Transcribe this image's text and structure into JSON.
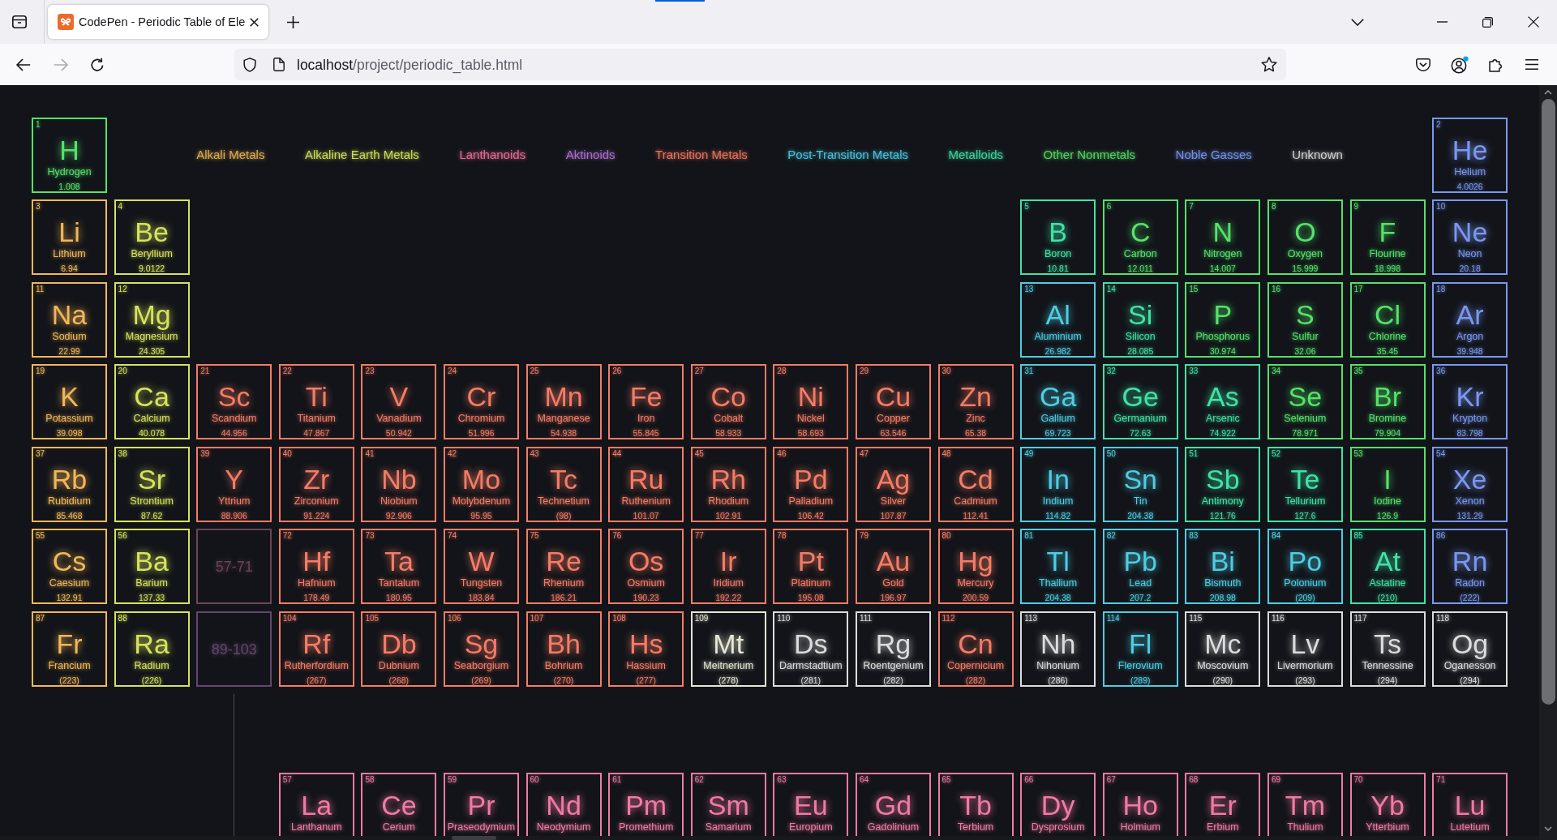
{
  "browser": {
    "tab": {
      "title": "CodePen - Periodic Table of Ele",
      "selected": true
    },
    "forward_button": {
      "disabled": true
    },
    "url": {
      "host": "localhost",
      "path": "/project/periodic_table.html"
    }
  },
  "legend": [
    {
      "label": "Alkali Metals",
      "color": "#dcaa50"
    },
    {
      "label": "Alkaline Earth Metals",
      "color": "#cbd956"
    },
    {
      "label": "Lanthanoids",
      "color": "#e56a94"
    },
    {
      "label": "Aktinoids",
      "color": "#a96cc9"
    },
    {
      "label": "Transition Metals",
      "color": "#e9715c"
    },
    {
      "label": "Post-Transition Metals",
      "color": "#47c2d9"
    },
    {
      "label": "Metalloids",
      "color": "#3bd49c"
    },
    {
      "label": "Other Nonmetals",
      "color": "#50d35f"
    },
    {
      "label": "Noble Gasses",
      "color": "#7290e6"
    },
    {
      "label": "Unknown",
      "color": "#cfcfcf"
    }
  ],
  "table": {
    "rows": [
      {
        "left": [
          {
            "kind": "element",
            "number": "1",
            "symbol": "H",
            "name": "Hydrogen",
            "weight": "1.008",
            "color": "#55e26a"
          }
        ],
        "right": [
          {
            "kind": "element",
            "number": "2",
            "symbol": "He",
            "name": "Helium",
            "weight": "4.0026",
            "color": "#7a98f2"
          }
        ]
      },
      {
        "left": [
          {
            "kind": "element",
            "number": "3",
            "symbol": "Li",
            "name": "Lithium",
            "weight": "6.94",
            "color": "#f2b75a"
          },
          {
            "kind": "element",
            "number": "4",
            "symbol": "Be",
            "name": "Beryllium",
            "weight": "9.0122",
            "color": "#d6e35c"
          }
        ],
        "right": [
          {
            "kind": "element",
            "number": "5",
            "symbol": "B",
            "name": "Boron",
            "weight": "10.81",
            "color": "#40e3a6"
          },
          {
            "kind": "element",
            "number": "6",
            "symbol": "C",
            "name": "Carbon",
            "weight": "12.011",
            "color": "#55e26a"
          },
          {
            "kind": "element",
            "number": "7",
            "symbol": "N",
            "name": "Nitrogen",
            "weight": "14.007",
            "color": "#55e26a"
          },
          {
            "kind": "element",
            "number": "8",
            "symbol": "O",
            "name": "Oxygen",
            "weight": "15.999",
            "color": "#55e26a"
          },
          {
            "kind": "element",
            "number": "9",
            "symbol": "F",
            "name": "Flourine",
            "weight": "18.998",
            "color": "#55e26a"
          },
          {
            "kind": "element",
            "number": "10",
            "symbol": "Ne",
            "name": "Neon",
            "weight": "20.18",
            "color": "#7a98f2"
          }
        ]
      },
      {
        "left": [
          {
            "kind": "element",
            "number": "11",
            "symbol": "Na",
            "name": "Sodium",
            "weight": "22.99",
            "color": "#f2b75a"
          },
          {
            "kind": "element",
            "number": "12",
            "symbol": "Mg",
            "name": "Magnesium",
            "weight": "24.305",
            "color": "#d6e35c"
          }
        ],
        "right": [
          {
            "kind": "element",
            "number": "13",
            "symbol": "Al",
            "name": "Aluminium",
            "weight": "26.982",
            "color": "#4fcde3"
          },
          {
            "kind": "element",
            "number": "14",
            "symbol": "Si",
            "name": "Silicon",
            "weight": "28.085",
            "color": "#40e3a6"
          },
          {
            "kind": "element",
            "number": "15",
            "symbol": "P",
            "name": "Phosphorus",
            "weight": "30.974",
            "color": "#55e26a"
          },
          {
            "kind": "element",
            "number": "16",
            "symbol": "S",
            "name": "Sulfur",
            "weight": "32.06",
            "color": "#55e26a"
          },
          {
            "kind": "element",
            "number": "17",
            "symbol": "Cl",
            "name": "Chlorine",
            "weight": "35.45",
            "color": "#55e26a"
          },
          {
            "kind": "element",
            "number": "18",
            "symbol": "Ar",
            "name": "Argon",
            "weight": "39.948",
            "color": "#7a98f2"
          }
        ]
      },
      {
        "left": [
          {
            "kind": "element",
            "number": "19",
            "symbol": "K",
            "name": "Potassium",
            "weight": "39.098",
            "color": "#f2b75a"
          },
          {
            "kind": "element",
            "number": "20",
            "symbol": "Ca",
            "name": "Calcium",
            "weight": "40.078",
            "color": "#d6e35c"
          },
          {
            "kind": "element",
            "number": "21",
            "symbol": "Sc",
            "name": "Scandium",
            "weight": "44.956",
            "color": "#f57c66"
          },
          {
            "kind": "element",
            "number": "22",
            "symbol": "Ti",
            "name": "Titanium",
            "weight": "47.867",
            "color": "#f57c66"
          },
          {
            "kind": "element",
            "number": "23",
            "symbol": "V",
            "name": "Vanadium",
            "weight": "50.942",
            "color": "#f57c66"
          },
          {
            "kind": "element",
            "number": "24",
            "symbol": "Cr",
            "name": "Chromium",
            "weight": "51.996",
            "color": "#f57c66"
          },
          {
            "kind": "element",
            "number": "25",
            "symbol": "Mn",
            "name": "Manganese",
            "weight": "54.938",
            "color": "#f57c66"
          },
          {
            "kind": "element",
            "number": "26",
            "symbol": "Fe",
            "name": "Iron",
            "weight": "55.845",
            "color": "#f57c66"
          },
          {
            "kind": "element",
            "number": "27",
            "symbol": "Co",
            "name": "Cobalt",
            "weight": "58.933",
            "color": "#f57c66"
          },
          {
            "kind": "element",
            "number": "28",
            "symbol": "Ni",
            "name": "Nickel",
            "weight": "58.693",
            "color": "#f57c66"
          },
          {
            "kind": "element",
            "number": "29",
            "symbol": "Cu",
            "name": "Copper",
            "weight": "63.546",
            "color": "#f57c66"
          },
          {
            "kind": "element",
            "number": "30",
            "symbol": "Zn",
            "name": "Zinc",
            "weight": "65.38",
            "color": "#f57c66"
          },
          {
            "kind": "element",
            "number": "31",
            "symbol": "Ga",
            "name": "Gallium",
            "weight": "69.723",
            "color": "#4fcde3"
          },
          {
            "kind": "element",
            "number": "32",
            "symbol": "Ge",
            "name": "Germanium",
            "weight": "72.63",
            "color": "#40e3a6"
          },
          {
            "kind": "element",
            "number": "33",
            "symbol": "As",
            "name": "Arsenic",
            "weight": "74.922",
            "color": "#40e3a6"
          },
          {
            "kind": "element",
            "number": "34",
            "symbol": "Se",
            "name": "Selenium",
            "weight": "78.971",
            "color": "#55e26a"
          },
          {
            "kind": "element",
            "number": "35",
            "symbol": "Br",
            "name": "Bromine",
            "weight": "79.904",
            "color": "#55e26a"
          },
          {
            "kind": "element",
            "number": "36",
            "symbol": "Kr",
            "name": "Krypton",
            "weight": "83.798",
            "color": "#7a98f2"
          }
        ]
      },
      {
        "left": [
          {
            "kind": "element",
            "number": "37",
            "symbol": "Rb",
            "name": "Rubidium",
            "weight": "85.468",
            "color": "#f2b75a"
          },
          {
            "kind": "element",
            "number": "38",
            "symbol": "Sr",
            "name": "Strontium",
            "weight": "87.62",
            "color": "#d6e35c"
          },
          {
            "kind": "element",
            "number": "39",
            "symbol": "Y",
            "name": "Yttrium",
            "weight": "88.906",
            "color": "#f57c66"
          },
          {
            "kind": "element",
            "number": "40",
            "symbol": "Zr",
            "name": "Zirconium",
            "weight": "91.224",
            "color": "#f57c66"
          },
          {
            "kind": "element",
            "number": "41",
            "symbol": "Nb",
            "name": "Niobium",
            "weight": "92.906",
            "color": "#f57c66"
          },
          {
            "kind": "element",
            "number": "42",
            "symbol": "Mo",
            "name": "Molybdenum",
            "weight": "95.95",
            "color": "#f57c66"
          },
          {
            "kind": "element",
            "number": "43",
            "symbol": "Tc",
            "name": "Technetium",
            "weight": "(98)",
            "color": "#f57c66"
          },
          {
            "kind": "element",
            "number": "44",
            "symbol": "Ru",
            "name": "Ruthenium",
            "weight": "101.07",
            "color": "#f57c66"
          },
          {
            "kind": "element",
            "number": "45",
            "symbol": "Rh",
            "name": "Rhodium",
            "weight": "102.91",
            "color": "#f57c66"
          },
          {
            "kind": "element",
            "number": "46",
            "symbol": "Pd",
            "name": "Palladium",
            "weight": "106.42",
            "color": "#f57c66"
          },
          {
            "kind": "element",
            "number": "47",
            "symbol": "Ag",
            "name": "Silver",
            "weight": "107.87",
            "color": "#f57c66"
          },
          {
            "kind": "element",
            "number": "48",
            "symbol": "Cd",
            "name": "Cadmium",
            "weight": "112.41",
            "color": "#f57c66"
          },
          {
            "kind": "element",
            "number": "49",
            "symbol": "In",
            "name": "Indium",
            "weight": "114.82",
            "color": "#4fcde3"
          },
          {
            "kind": "element",
            "number": "50",
            "symbol": "Sn",
            "name": "Tin",
            "weight": "204.38",
            "color": "#4fcde3"
          },
          {
            "kind": "element",
            "number": "51",
            "symbol": "Sb",
            "name": "Antimony",
            "weight": "121.76",
            "color": "#40e3a6"
          },
          {
            "kind": "element",
            "number": "52",
            "symbol": "Te",
            "name": "Tellurium",
            "weight": "127.6",
            "color": "#40e3a6"
          },
          {
            "kind": "element",
            "number": "53",
            "symbol": "I",
            "name": "Iodine",
            "weight": "126.9",
            "color": "#55e26a"
          },
          {
            "kind": "element",
            "number": "54",
            "symbol": "Xe",
            "name": "Xenon",
            "weight": "131.29",
            "color": "#7a98f2"
          }
        ]
      },
      {
        "left": [
          {
            "kind": "element",
            "number": "55",
            "symbol": "Cs",
            "name": "Caesium",
            "weight": "132.91",
            "color": "#f2b75a"
          },
          {
            "kind": "element",
            "number": "56",
            "symbol": "Ba",
            "name": "Barium",
            "weight": "137.33",
            "color": "#d6e35c"
          },
          {
            "kind": "placeholder",
            "label": "57-71",
            "color": "#6b4556"
          },
          {
            "kind": "element",
            "number": "72",
            "symbol": "Hf",
            "name": "Hafnium",
            "weight": "178.49",
            "color": "#f57c66"
          },
          {
            "kind": "element",
            "number": "73",
            "symbol": "Ta",
            "name": "Tantalum",
            "weight": "180.95",
            "color": "#f57c66"
          },
          {
            "kind": "element",
            "number": "74",
            "symbol": "W",
            "name": "Tungsten",
            "weight": "183.84",
            "color": "#f57c66"
          },
          {
            "kind": "element",
            "number": "75",
            "symbol": "Re",
            "name": "Rhenium",
            "weight": "186.21",
            "color": "#f57c66"
          },
          {
            "kind": "element",
            "number": "76",
            "symbol": "Os",
            "name": "Osmium",
            "weight": "190.23",
            "color": "#f57c66"
          },
          {
            "kind": "element",
            "number": "77",
            "symbol": "Ir",
            "name": "Iridium",
            "weight": "192.22",
            "color": "#f57c66"
          },
          {
            "kind": "element",
            "number": "78",
            "symbol": "Pt",
            "name": "Platinum",
            "weight": "195.08",
            "color": "#f57c66"
          },
          {
            "kind": "element",
            "number": "79",
            "symbol": "Au",
            "name": "Gold",
            "weight": "196.97",
            "color": "#f57c66"
          },
          {
            "kind": "element",
            "number": "80",
            "symbol": "Hg",
            "name": "Mercury",
            "weight": "200.59",
            "color": "#f57c66"
          },
          {
            "kind": "element",
            "number": "81",
            "symbol": "Tl",
            "name": "Thallium",
            "weight": "204.38",
            "color": "#4fcde3"
          },
          {
            "kind": "element",
            "number": "82",
            "symbol": "Pb",
            "name": "Lead",
            "weight": "207.2",
            "color": "#4fcde3"
          },
          {
            "kind": "element",
            "number": "83",
            "symbol": "Bi",
            "name": "Bismuth",
            "weight": "208.98",
            "color": "#4fcde3"
          },
          {
            "kind": "element",
            "number": "84",
            "symbol": "Po",
            "name": "Polonium",
            "weight": "(209)",
            "color": "#4fcde3"
          },
          {
            "kind": "element",
            "number": "85",
            "symbol": "At",
            "name": "Astatine",
            "weight": "(210)",
            "color": "#40e3a6"
          },
          {
            "kind": "element",
            "number": "86",
            "symbol": "Rn",
            "name": "Radon",
            "weight": "(222)",
            "color": "#7a98f2"
          }
        ]
      },
      {
        "left": [
          {
            "kind": "element",
            "number": "87",
            "symbol": "Fr",
            "name": "Francium",
            "weight": "(223)",
            "color": "#f2b75a"
          },
          {
            "kind": "element",
            "number": "88",
            "symbol": "Ra",
            "name": "Radium",
            "weight": "(226)",
            "color": "#d6e35c"
          },
          {
            "kind": "placeholder",
            "label": "89-103",
            "color": "#62476c"
          },
          {
            "kind": "element",
            "number": "104",
            "symbol": "Rf",
            "name": "Rutherfordium",
            "weight": "(267)",
            "color": "#f57c66"
          },
          {
            "kind": "element",
            "number": "105",
            "symbol": "Db",
            "name": "Dubnium",
            "weight": "(268)",
            "color": "#f57c66"
          },
          {
            "kind": "element",
            "number": "106",
            "symbol": "Sg",
            "name": "Seaborgium",
            "weight": "(269)",
            "color": "#f57c66"
          },
          {
            "kind": "element",
            "number": "107",
            "symbol": "Bh",
            "name": "Bohrium",
            "weight": "(270)",
            "color": "#f57c66"
          },
          {
            "kind": "element",
            "number": "108",
            "symbol": "Hs",
            "name": "Hassium",
            "weight": "(277)",
            "color": "#f57c66"
          },
          {
            "kind": "element",
            "number": "109",
            "symbol": "Mt",
            "name": "Meitnerium",
            "weight": "(278)",
            "color": "#e6e6d2"
          },
          {
            "kind": "element",
            "number": "110",
            "symbol": "Ds",
            "name": "Darmstadtium",
            "weight": "(281)",
            "color": "#dcdcdc"
          },
          {
            "kind": "element",
            "number": "111",
            "symbol": "Rg",
            "name": "Roentgenium",
            "weight": "(282)",
            "color": "#dcdcdc"
          },
          {
            "kind": "element",
            "number": "112",
            "symbol": "Cn",
            "name": "Copernicium",
            "weight": "(282)",
            "color": "#f57c66"
          },
          {
            "kind": "element",
            "number": "113",
            "symbol": "Nh",
            "name": "Nihonium",
            "weight": "(286)",
            "color": "#dcdcdc"
          },
          {
            "kind": "element",
            "number": "114",
            "symbol": "Fl",
            "name": "Flerovium",
            "weight": "(289)",
            "color": "#4fcde3"
          },
          {
            "kind": "element",
            "number": "115",
            "symbol": "Mc",
            "name": "Moscovium",
            "weight": "(290)",
            "color": "#dcdcdc"
          },
          {
            "kind": "element",
            "number": "116",
            "symbol": "Lv",
            "name": "Livermorium",
            "weight": "(293)",
            "color": "#dcdcdc"
          },
          {
            "kind": "element",
            "number": "117",
            "symbol": "Ts",
            "name": "Tennessine",
            "weight": "(294)",
            "color": "#dcdcdc"
          },
          {
            "kind": "element",
            "number": "118",
            "symbol": "Og",
            "name": "Oganesson",
            "weight": "(294)",
            "color": "#dcdcdc"
          }
        ]
      }
    ],
    "lanthanides": [
      {
        "kind": "element",
        "number": "57",
        "symbol": "La",
        "name": "Lanthanum",
        "color": "#f27aa3"
      },
      {
        "kind": "element",
        "number": "58",
        "symbol": "Ce",
        "name": "Cerium",
        "color": "#f27aa3"
      },
      {
        "kind": "element",
        "number": "59",
        "symbol": "Pr",
        "name": "Praseodymium",
        "color": "#f27aa3"
      },
      {
        "kind": "element",
        "number": "60",
        "symbol": "Nd",
        "name": "Neodymium",
        "color": "#f27aa3"
      },
      {
        "kind": "element",
        "number": "61",
        "symbol": "Pm",
        "name": "Promethium",
        "color": "#f27aa3"
      },
      {
        "kind": "element",
        "number": "62",
        "symbol": "Sm",
        "name": "Samarium",
        "color": "#f27aa3"
      },
      {
        "kind": "element",
        "number": "63",
        "symbol": "Eu",
        "name": "Europium",
        "color": "#f27aa3"
      },
      {
        "kind": "element",
        "number": "64",
        "symbol": "Gd",
        "name": "Gadolinium",
        "color": "#f27aa3"
      },
      {
        "kind": "element",
        "number": "65",
        "symbol": "Tb",
        "name": "Terbium",
        "color": "#f27aa3"
      },
      {
        "kind": "element",
        "number": "66",
        "symbol": "Dy",
        "name": "Dysprosium",
        "color": "#f27aa3"
      },
      {
        "kind": "element",
        "number": "67",
        "symbol": "Ho",
        "name": "Holmium",
        "color": "#f27aa3"
      },
      {
        "kind": "element",
        "number": "68",
        "symbol": "Er",
        "name": "Erbium",
        "color": "#f27aa3"
      },
      {
        "kind": "element",
        "number": "69",
        "symbol": "Tm",
        "name": "Thulium",
        "color": "#f27aa3"
      },
      {
        "kind": "element",
        "number": "70",
        "symbol": "Yb",
        "name": "Ytterbium",
        "color": "#f27aa3"
      },
      {
        "kind": "element",
        "number": "71",
        "symbol": "Lu",
        "name": "Lutetium",
        "color": "#f27aa3"
      }
    ]
  }
}
